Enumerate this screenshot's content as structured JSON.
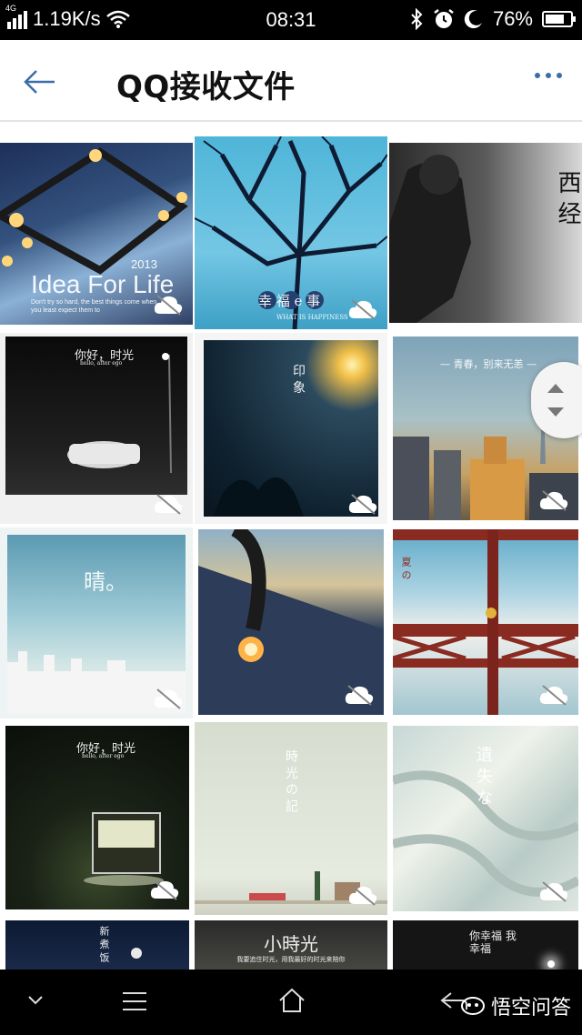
{
  "status_bar": {
    "network_type": "4G",
    "speed": "1.19K/s",
    "time": "08:31",
    "battery": "76%",
    "battery_level": 0.76,
    "icons": [
      "signal-icon",
      "wifi-icon",
      "bluetooth-icon",
      "alarm-icon",
      "moon-icon",
      "battery-icon"
    ]
  },
  "app_bar": {
    "title": "QQ接收文件",
    "back_icon": "arrow-left-icon",
    "more_icon": "more-dots-icon",
    "accent_color": "#3a6ea8"
  },
  "tiles": [
    {
      "caption": "Idea For Life",
      "sub": "2013",
      "extra": "Don't try so hard, the best things come when you least expect them to",
      "icon": "cloud-off-icon"
    },
    {
      "caption": "幸 福 e 事",
      "sub": "WHAT IS HAPPINESS",
      "icon": "cloud-off-icon"
    },
    {
      "caption": "西 经",
      "icon": "cloud-off-icon"
    },
    {
      "caption": "你好，时光",
      "sub": "hello, after ego",
      "icon": "cloud-off-icon"
    },
    {
      "caption": "印 象",
      "icon": "cloud-off-icon"
    },
    {
      "caption": "— 青春，别来无恙 —",
      "icon": "cloud-off-icon"
    },
    {
      "caption": "晴。",
      "icon": "cloud-off-icon"
    },
    {
      "caption": "",
      "icon": "cloud-off-icon"
    },
    {
      "caption": "夏 の",
      "icon": "cloud-off-icon"
    },
    {
      "caption": "你好，时光",
      "sub": "hello, after ego",
      "icon": "cloud-off-icon"
    },
    {
      "caption": "時 光 の 記",
      "icon": "cloud-off-icon"
    },
    {
      "caption": "遺 失 な",
      "icon": "cloud-off-icon"
    },
    {
      "caption": "新 煮 饭",
      "icon": "cloud-off-icon"
    },
    {
      "caption": "小時光",
      "sub": "我要追住时光，用我最好的时光来陪你",
      "icon": "cloud-off-icon"
    },
    {
      "caption": "你幸福 我幸福",
      "icon": "cloud-off-icon"
    }
  ],
  "navigation_bar": {
    "items": [
      "chevron-down-icon",
      "menu-icon",
      "home-icon",
      "back-icon"
    ]
  },
  "watermark": {
    "text": "悟空问答"
  }
}
